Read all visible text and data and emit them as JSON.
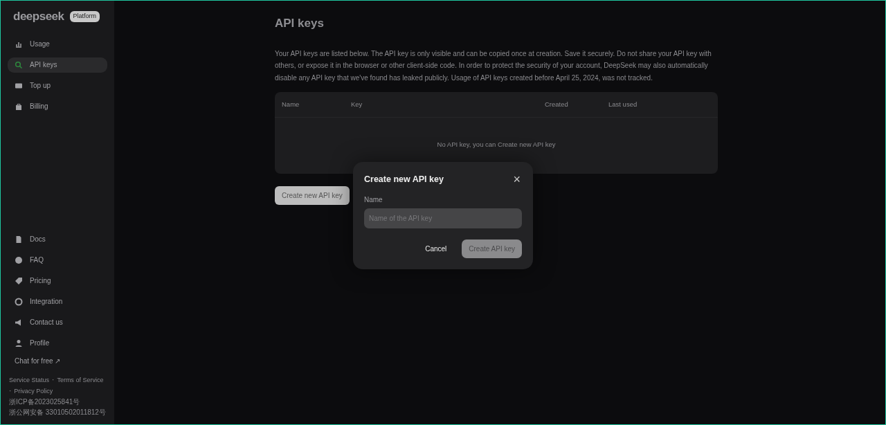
{
  "sidebar": {
    "logo": "deepseek",
    "badge": "Platform",
    "items": [
      {
        "label": "Usage",
        "selected": false
      },
      {
        "label": "API keys",
        "selected": true
      },
      {
        "label": "Top up",
        "selected": false
      },
      {
        "label": "Billing",
        "selected": false
      }
    ],
    "bottom_items": [
      {
        "label": "Docs"
      },
      {
        "label": "FAQ"
      },
      {
        "label": "Pricing"
      },
      {
        "label": "Integration"
      },
      {
        "label": "Contact us"
      },
      {
        "label": "Profile"
      }
    ],
    "separator": "·",
    "chat_link": "Chat for free ↗",
    "footer_links": [
      "Service Status",
      "Terms of Service",
      "Privacy Policy"
    ],
    "footer_lines": [
      "浙ICP备2023025841号",
      "浙公网安备 33010502011812号"
    ]
  },
  "page": {
    "title": "API keys",
    "description": "Your API keys are listed below. The API key is only visible and can be copied once at creation. Save it securely. Do not share your API key with others, or expose it in the browser or other client-side code. In order to protect the security of your account, DeepSeek may also automatically disable any API key that we've found has leaked publicly. Usage of API keys created before April 25, 2024, was not tracked.",
    "table": {
      "columns": [
        "Name",
        "Key",
        "Created",
        "Last used"
      ],
      "empty_text": "No API key, you can ",
      "empty_link": "Create new API key"
    },
    "create_button": "Create new API key"
  },
  "dialog": {
    "title": "Create new API key",
    "close": "×",
    "field_label": "Name",
    "placeholder": "Name of the API key",
    "cancel": "Cancel",
    "submit": "Create API key",
    "submit_disabled": true
  }
}
